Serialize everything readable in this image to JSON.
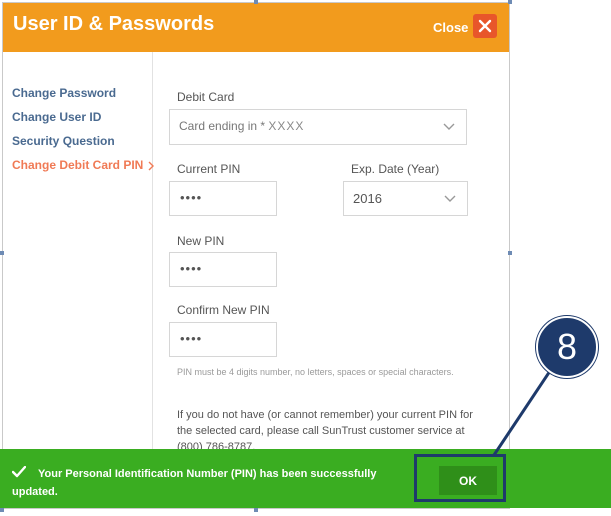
{
  "dialog": {
    "title": "User ID & Passwords",
    "close_label": "Close",
    "close_icon": "close-x-icon"
  },
  "sidebar": {
    "items": [
      {
        "label": "Change Password",
        "active": false
      },
      {
        "label": "Change User ID",
        "active": false
      },
      {
        "label": "Security Question",
        "active": false
      },
      {
        "label": "Change Debit Card PIN",
        "active": true
      }
    ]
  },
  "form": {
    "debit_card_label": "Debit Card",
    "debit_card_value": "Card ending in *",
    "debit_card_mask": "XXXX",
    "current_pin_label": "Current PIN",
    "current_pin_value": "••••",
    "exp_date_label": "Exp. Date (Year)",
    "exp_date_value": "2016",
    "new_pin_label": "New PIN",
    "new_pin_value": "••••",
    "confirm_pin_label": "Confirm New PIN",
    "confirm_pin_value": "••••",
    "hint": "PIN must be 4 digits number, no letters, spaces or special characters.",
    "info": "If you do not have (or cannot remember) your current PIN for the selected card, please call SunTrust customer service at (800) 786-8787."
  },
  "success": {
    "message": "Your Personal Identification Number (PIN) has been successfully updated.",
    "ok_label": "OK",
    "icon": "checkmark-icon"
  },
  "callout": {
    "number": "8"
  },
  "colors": {
    "header": "#f29b1d",
    "close_button": "#e8562a",
    "nav_text": "#4a6a90",
    "nav_active": "#f07a55",
    "success": "#3aad21",
    "ok_button": "#2f8f19",
    "callout": "#1e3a6b"
  }
}
